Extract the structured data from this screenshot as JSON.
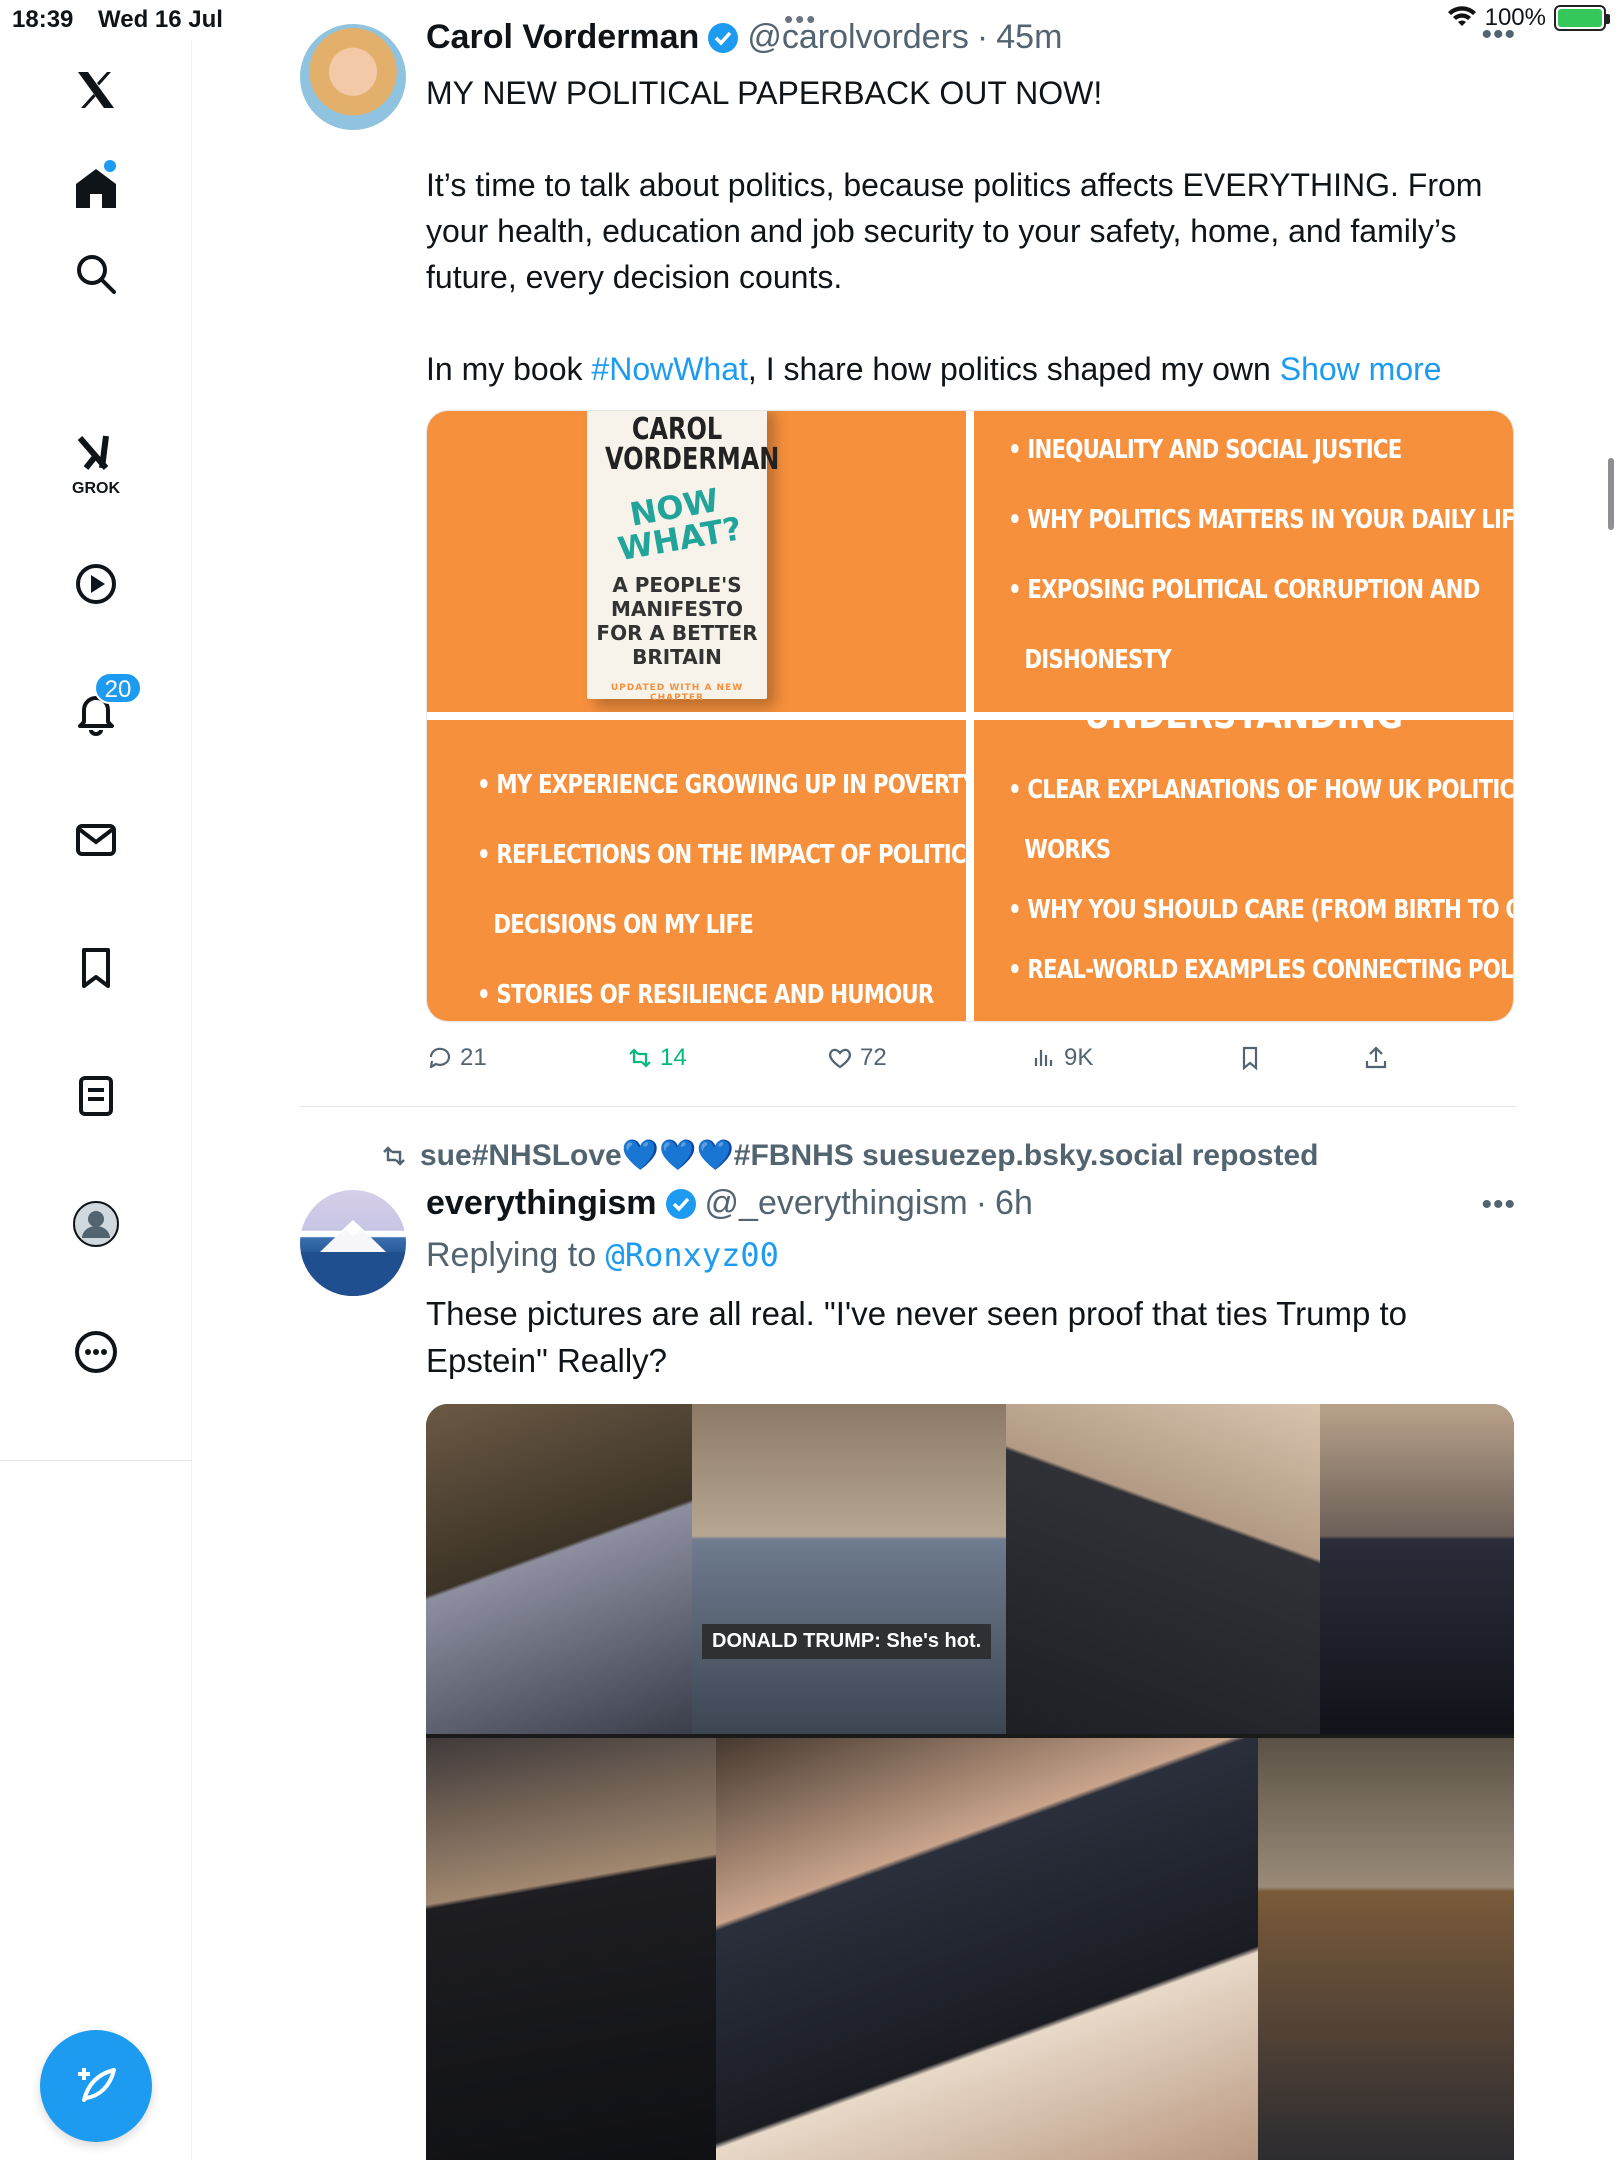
{
  "status_bar": {
    "time": "18:39",
    "date": "Wed 16 Jul",
    "battery": "100%",
    "battery_level": 1.0
  },
  "sidebar": {
    "items": [
      {
        "name": "x-logo-icon"
      },
      {
        "name": "home-icon"
      },
      {
        "name": "search-icon"
      },
      {
        "name": "grok-icon",
        "label": "GROK"
      },
      {
        "name": "video-icon"
      },
      {
        "name": "notifications-icon",
        "badge": "20"
      },
      {
        "name": "messages-icon"
      },
      {
        "name": "bookmarks-icon"
      },
      {
        "name": "lists-icon"
      },
      {
        "name": "profile-icon"
      },
      {
        "name": "more-icon"
      }
    ],
    "accent": "#1d9bf0"
  },
  "tweet1": {
    "name": "Carol Vorderman",
    "handle": "@carolvorders",
    "time": "45m",
    "line1": "MY NEW POLITICAL PAPERBACK OUT NOW!",
    "para2": "It’s time to talk about politics, because politics affects EVERYTHING. From your health, education and job security to your safety, home, and family’s future, every decision counts.",
    "para3_pre": "In my book ",
    "hashtag": "#NowWhat",
    "para3_post": ", I share how politics shaped my own ",
    "show_more": "Show more",
    "media": {
      "book_author_1": "CAROL",
      "book_author_2": "VORDERMAN",
      "book_title_1": "NOW",
      "book_title_2": "WHAT?",
      "book_sub_1": "A PEOPLE'S",
      "book_sub_2": "MANIFESTO",
      "book_sub_3": "FOR A BETTER",
      "book_sub_4": "BRITAIN",
      "book_foot": "UPDATED WITH A NEW CHAPTER",
      "tile2": [
        "INEQUALITY AND SOCIAL JUSTICE",
        "WHY POLITICS MATTERS IN YOUR DAILY LIFE",
        "EXPOSING POLITICAL CORRUPTION AND",
        "DISHONESTY"
      ],
      "tile3": [
        "MY EXPERIENCE GROWING UP IN POVERTY",
        "REFLECTIONS ON THE IMPACT OF POLITICAL",
        "DECISIONS ON MY LIFE",
        "STORIES OF RESILIENCE AND HUMOUR"
      ],
      "tile4_cut": "UNDERSTANDING",
      "tile4": [
        "CLEAR EXPLANATIONS OF HOW UK POLITICS",
        "WORKS",
        "WHY YOU SHOULD CARE (FROM BIRTH TO OLD AGE)",
        "REAL-WORLD EXAMPLES CONNECTING POLITICS TO"
      ]
    },
    "replies": "21",
    "reposts": "14",
    "likes": "72",
    "views": "9K"
  },
  "repost_line": "sue#NHSLove💙💙💙#FBNHS suesuezep.bsky.social reposted",
  "tweet2": {
    "name": "everythingism",
    "handle": "@_everythingism",
    "time": "6h",
    "replying_to_label": "Replying to ",
    "replying_to_handle": "@Ronxyz00",
    "text": "These pictures are all real. \"I've never seen proof that ties Trump to Epstein\" Really?",
    "caption": "DONALD TRUMP: She's hot."
  },
  "colors": {
    "accent": "#1d9bf0",
    "orange": "#f6903d",
    "repost_green": "#00ba7c",
    "muted": "#536471"
  }
}
